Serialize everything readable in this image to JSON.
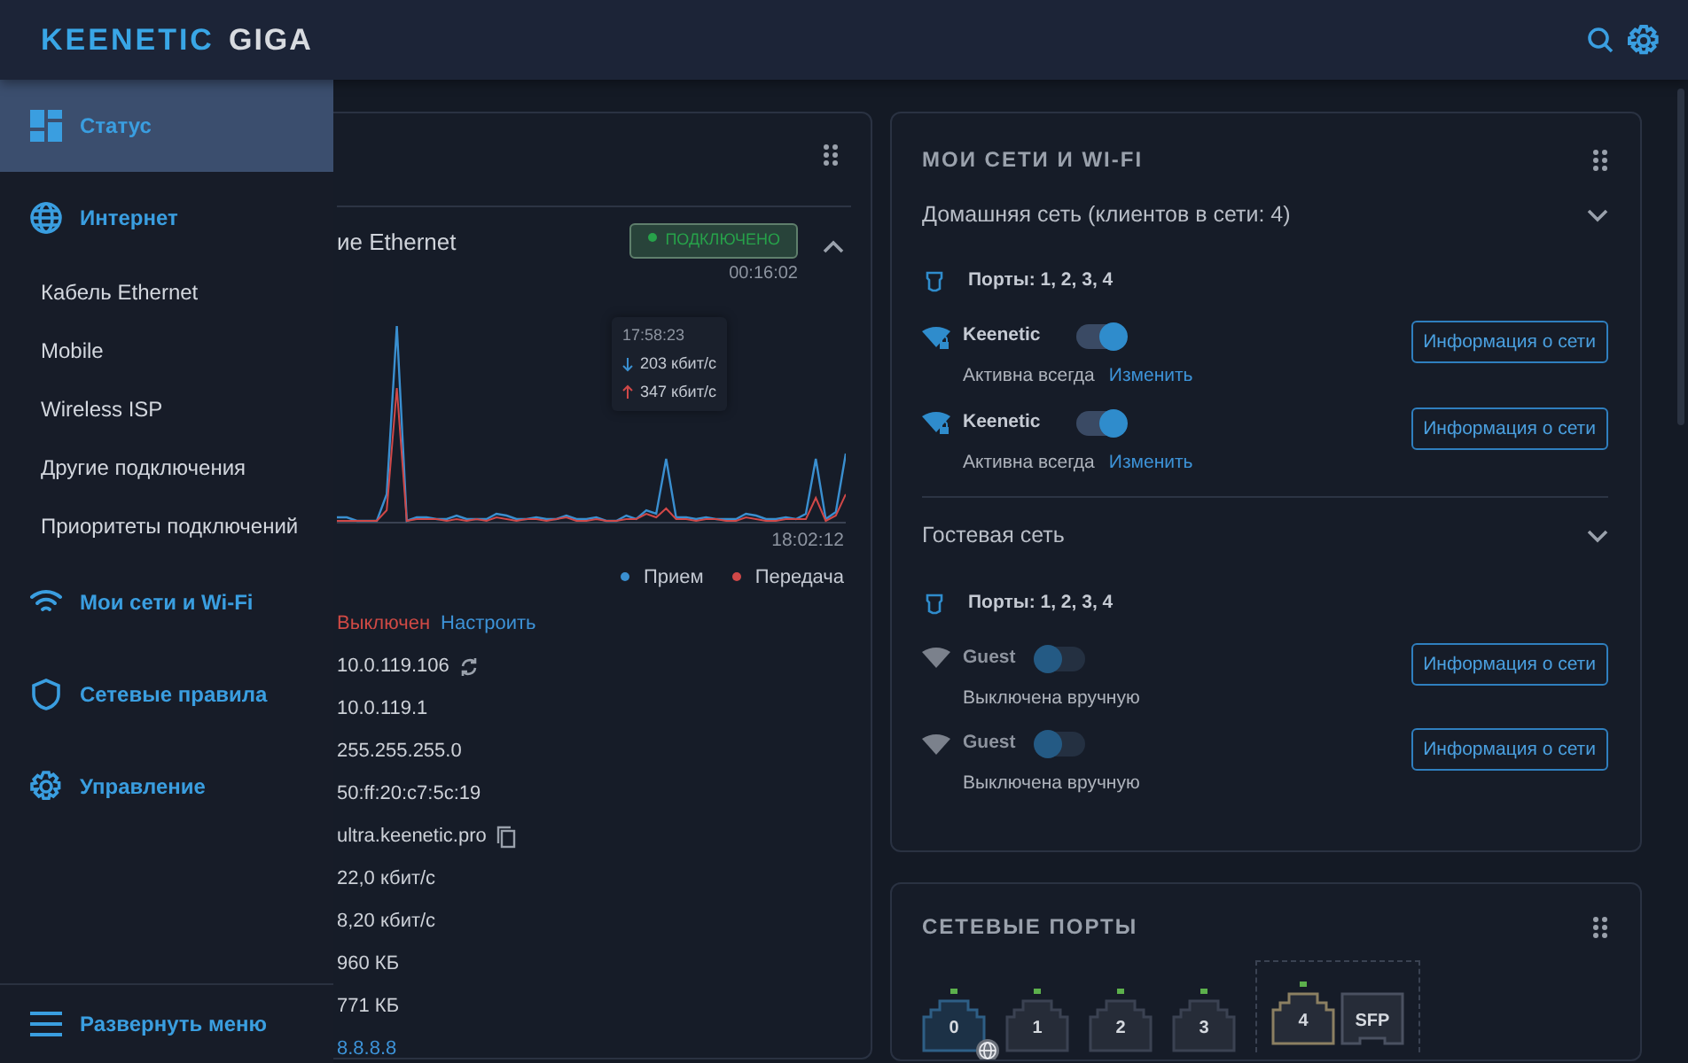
{
  "header": {
    "brand": "KEENETIC",
    "model": "GIGA"
  },
  "sidebar": {
    "items": [
      {
        "label": "Статус",
        "selected": true
      },
      {
        "label": "Интернет",
        "selected": false,
        "children": [
          {
            "label": "Кабель Ethernet"
          },
          {
            "label": "Mobile"
          },
          {
            "label": "Wireless ISP"
          },
          {
            "label": "Другие подключения"
          },
          {
            "label": "Приоритеты подключений"
          }
        ]
      },
      {
        "label": "Мои сети и Wi-Fi",
        "selected": false
      },
      {
        "label": "Сетевые правила",
        "selected": false
      },
      {
        "label": "Управление",
        "selected": false
      }
    ],
    "footer": "Развернуть меню"
  },
  "internet_card": {
    "connection_title": "ие Ethernet",
    "status": "ПОДКЛЮЧЕНО",
    "uptime": "00:16:02",
    "expanded": true,
    "tooltip": {
      "time": "17:58:23",
      "download": "203 кбит/с",
      "upload": "347 кбит/с"
    },
    "time_label": "18:02:12",
    "legend": [
      {
        "label": "Прием",
        "color": "#3a8fd0"
      },
      {
        "label": "Передача",
        "color": "#d04848"
      }
    ],
    "rows": [
      {
        "kind": "state",
        "text": "Выключен",
        "link": "Настроить"
      },
      {
        "kind": "refresh",
        "text": "10.0.119.106"
      },
      {
        "kind": "plain",
        "text": "10.0.119.1"
      },
      {
        "kind": "plain",
        "text": "255.255.255.0"
      },
      {
        "kind": "plain",
        "text": "50:ff:20:c7:5c:19"
      },
      {
        "kind": "copy",
        "text": "ultra.keenetic.pro"
      },
      {
        "kind": "plain",
        "text": "22,0 кбит/с"
      },
      {
        "kind": "plain",
        "text": "8,20 кбит/с"
      },
      {
        "kind": "plain",
        "text": "960 КБ"
      },
      {
        "kind": "plain",
        "text": "771 КБ"
      },
      {
        "kind": "link",
        "text": "8.8.8.8"
      }
    ]
  },
  "networks_card": {
    "title": "МОИ СЕТИ И WI-FI",
    "groups": [
      {
        "title": "Домашняя сеть (клиентов в сети: 4)",
        "expanded": false,
        "ports": "Порты: 1, 2, 3, 4",
        "wifi": [
          {
            "name": "Keenetic",
            "on": true,
            "status": "Активна всегда",
            "link": "Изменить",
            "button": "Информация о сети"
          },
          {
            "name": "Keenetic",
            "on": true,
            "status": "Активна всегда",
            "link": "Изменить",
            "button": "Информация о сети"
          }
        ]
      },
      {
        "title": "Гостевая сеть",
        "expanded": false,
        "ports": "Порты: 1, 2, 3, 4",
        "wifi": [
          {
            "name": "Guest",
            "on": false,
            "status": "Выключена вручную",
            "button": "Информация о сети"
          },
          {
            "name": "Guest",
            "on": false,
            "status": "Выключена вручную",
            "button": "Информация о сети"
          }
        ]
      }
    ]
  },
  "ports_card": {
    "title": "СЕТЕВЫЕ ПОРТЫ",
    "ports": [
      {
        "label": "0",
        "kind": "rj45",
        "link": true,
        "internet": true,
        "color": "#2e5f86"
      },
      {
        "label": "1",
        "kind": "rj45",
        "link": true,
        "internet": false,
        "color": "#3b4252"
      },
      {
        "label": "2",
        "kind": "rj45",
        "link": true,
        "internet": false,
        "color": "#3b4252"
      },
      {
        "label": "3",
        "kind": "rj45",
        "link": true,
        "internet": false,
        "color": "#3b4252"
      }
    ],
    "combo_ports": [
      {
        "label": "4",
        "kind": "rj45",
        "link": true,
        "internet": false,
        "color": "#8c8062"
      },
      {
        "label": "SFP",
        "kind": "sfp",
        "link": false,
        "internet": false,
        "color": "#4a5161"
      }
    ]
  }
}
